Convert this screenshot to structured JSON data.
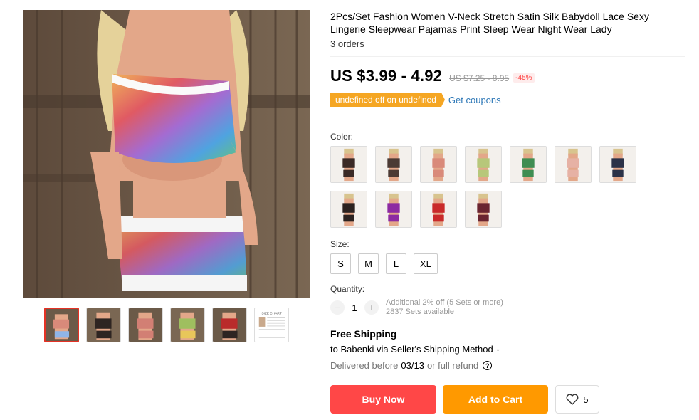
{
  "product": {
    "title": "2Pcs/Set Fashion Women V-Neck Stretch Satin Silk Babydoll Lace Sexy Lingerie Sleepwear Pajamas Print Sleep Wear Night Wear Lady",
    "orders": "3 orders"
  },
  "price": {
    "current": "US $3.99 - 4.92",
    "original": "US $7.25 - 8.95",
    "discount": "-45%"
  },
  "coupon": {
    "badge": "undefined off on undefined",
    "link": "Get coupons"
  },
  "color": {
    "label": "Color:",
    "swatches": [
      {
        "icon": "pajama-black-print-swatch",
        "accent": "#3a2a26"
      },
      {
        "icon": "pajama-dark-print-swatch",
        "accent": "#4b3a34"
      },
      {
        "icon": "pajama-pink-butterfly-swatch",
        "accent": "#d98a7a"
      },
      {
        "icon": "pajama-butterfly-swatch",
        "accent": "#b7c77a"
      },
      {
        "icon": "pajama-green-print-swatch",
        "accent": "#3f8d52"
      },
      {
        "icon": "pajama-light-floral-swatch",
        "accent": "#e6b1a4"
      },
      {
        "icon": "pajama-navy-print-swatch",
        "accent": "#2b3248"
      },
      {
        "icon": "pajama-black-leopard-swatch",
        "accent": "#2b2220"
      },
      {
        "icon": "pajama-purple-print-swatch",
        "accent": "#8d2aa2"
      },
      {
        "icon": "pajama-red-print-swatch",
        "accent": "#c92a2a"
      },
      {
        "icon": "pajama-maroon-print-swatch",
        "accent": "#6a2430"
      }
    ]
  },
  "size": {
    "label": "Size:",
    "options": [
      "S",
      "M",
      "L",
      "XL"
    ]
  },
  "quantity": {
    "label": "Quantity:",
    "value": "1",
    "minus": "−",
    "plus": "+",
    "note_line1": "Additional 2% off (5 Sets or more)",
    "note_line2": "2837 Sets available"
  },
  "shipping": {
    "title": "Free Shipping",
    "to": "to Babenki via Seller's Shipping Method",
    "delivered_prefix": "Delivered before",
    "delivered_date": "03/13",
    "delivered_suffix": "or full refund",
    "help_glyph": "?"
  },
  "actions": {
    "buy_now": "Buy Now",
    "add_to_cart": "Add to Cart",
    "wishlist_count": "5"
  },
  "gallery": {
    "thumbnails": [
      {
        "icon": "thumb-butterfly-pajama-icon",
        "accent": "#d98a7a",
        "active": true
      },
      {
        "icon": "thumb-black-pajama-icon",
        "accent": "#2e2522",
        "active": false
      },
      {
        "icon": "thumb-pink-pajama-icon",
        "accent": "#d27f74",
        "active": false
      },
      {
        "icon": "thumb-green-pajama-icon",
        "accent": "#9fbf5f",
        "active": false
      },
      {
        "icon": "thumb-red-pajama-icon",
        "accent": "#b92b2b",
        "active": false
      },
      {
        "icon": "size-chart-icon",
        "accent": "#888888",
        "active": false
      }
    ],
    "size_chart_text": "SIZE CHART"
  },
  "colors": {
    "buy_now": "#ff4747",
    "add_to_cart": "#ff9900",
    "coupon": "#f5a623",
    "link": "#2e78b7",
    "active_thumb": "#e43225"
  }
}
